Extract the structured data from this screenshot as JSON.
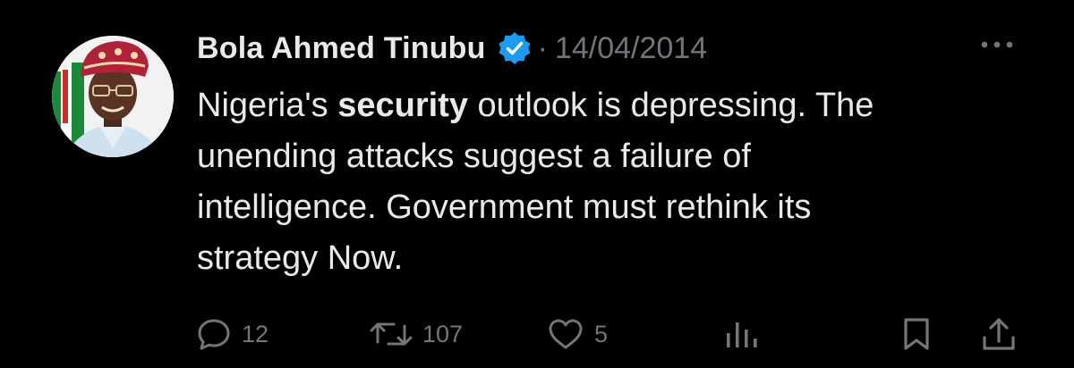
{
  "tweet": {
    "author_name": "Bola Ahmed Tinubu",
    "verified": true,
    "separator": "·",
    "date": "14/04/2014",
    "body": {
      "line_1_prefix": "Nigeria's ",
      "line_1_bold": "security",
      "line_1_suffix": " outlook is depressing. The",
      "line_2": "unending attacks suggest a failure of",
      "line_3": "intelligence. Government must rethink its",
      "line_4": "strategy Now."
    }
  },
  "actions": {
    "reply": {
      "icon": "reply-icon",
      "count": "12"
    },
    "retweet": {
      "icon": "retweet-icon",
      "count": "107"
    },
    "like": {
      "icon": "heart-icon",
      "count": "5"
    },
    "views": {
      "icon": "views-chart-icon"
    },
    "bookmark": {
      "icon": "bookmark-icon"
    },
    "share": {
      "icon": "share-icon"
    },
    "more": {
      "icon": "more-options-icon"
    }
  },
  "colors": {
    "background": "#000000",
    "primary_text": "#e7e9ea",
    "secondary_text": "#71767b",
    "verified_badge": "#1d9bf0"
  }
}
